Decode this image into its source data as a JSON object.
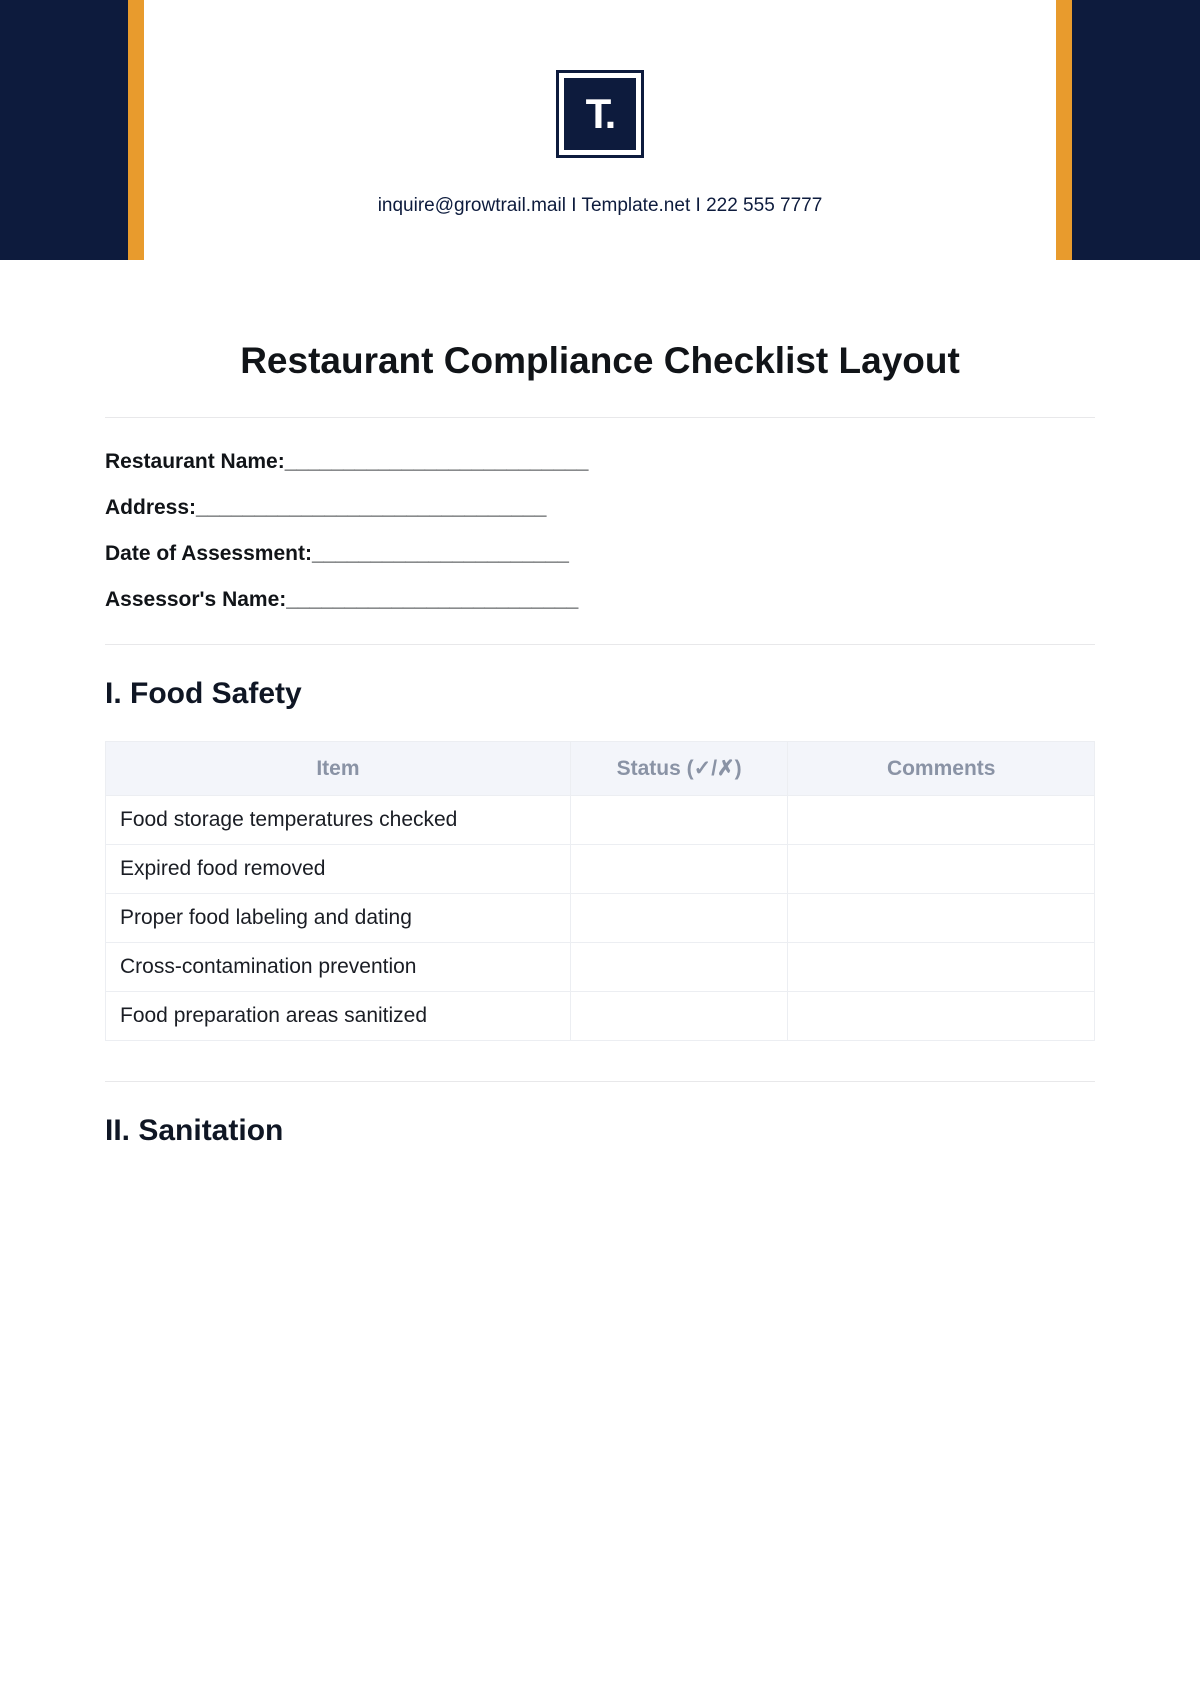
{
  "header": {
    "logo_text": "T.",
    "contact_email": "inquire@growtrail.mail",
    "contact_site": "Template.net",
    "contact_phone": "222 555 7777",
    "separator": "  I  "
  },
  "title": "Restaurant Compliance Checklist Layout",
  "fields": [
    {
      "label": "Restaurant Name:",
      "line": " __________________________"
    },
    {
      "label": "Address:",
      "line": " ______________________________"
    },
    {
      "label": "Date of Assessment:",
      "line": " ______________________"
    },
    {
      "label": "Assessor's Name:",
      "line": " _________________________"
    }
  ],
  "table_headers": {
    "item": "Item",
    "status": "Status (✓/✗)",
    "comments": "Comments"
  },
  "sections": [
    {
      "heading": "I. Food Safety",
      "rows": [
        {
          "item": "Food storage temperatures checked",
          "status": "",
          "comments": ""
        },
        {
          "item": "Expired food removed",
          "status": "",
          "comments": ""
        },
        {
          "item": "Proper food labeling and dating",
          "status": "",
          "comments": ""
        },
        {
          "item": "Cross-contamination prevention",
          "status": "",
          "comments": ""
        },
        {
          "item": "Food preparation areas sanitized",
          "status": "",
          "comments": ""
        }
      ]
    },
    {
      "heading": "II. Sanitation",
      "rows": []
    }
  ]
}
